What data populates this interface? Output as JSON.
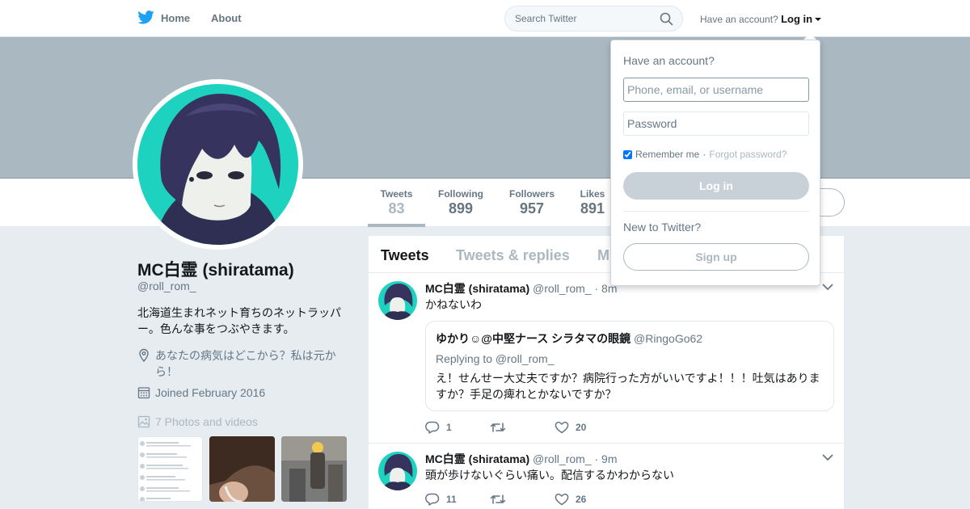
{
  "nav": {
    "home_label": "Home",
    "about_label": "About",
    "search_placeholder": "Search Twitter",
    "have_account": "Have an account?",
    "login_label": "Log in"
  },
  "profile": {
    "name": "MC白霊 (shiratama)",
    "handle": "@roll_rom_",
    "bio": "北海道生まれネット育ちのネットラッパー。色んな事をつぶやきます。",
    "location": "あなたの病気はどこから？私は元から！",
    "joined": "Joined February 2016",
    "photos_label": "7 Photos and videos"
  },
  "stats": [
    {
      "label": "Tweets",
      "value": "83"
    },
    {
      "label": "Following",
      "value": "899"
    },
    {
      "label": "Followers",
      "value": "957"
    },
    {
      "label": "Likes",
      "value": "891"
    }
  ],
  "timeline": {
    "tabs": [
      "Tweets",
      "Tweets & replies",
      "M"
    ],
    "tweets": [
      {
        "name": "MC白霊 (shiratama)",
        "handle": "@roll_rom_",
        "time": "· 8m",
        "text": "かねないわ",
        "quote": {
          "name": "ゆかり☺@中堅ナース シラタマの眼鏡",
          "handle": "@RingoGo62",
          "reply": "Replying to @roll_rom_",
          "text": "え！せんせー大丈夫ですか？病院行った方がいいですよ！！！吐気はありますか？手足の痺れとかないですか？"
        },
        "replies": "1",
        "retweets": "",
        "likes": "20"
      },
      {
        "name": "MC白霊 (shiratama)",
        "handle": "@roll_rom_",
        "time": "· 9m",
        "text": "頭が歩けないぐらい痛い。配信するかわからない",
        "replies": "11",
        "retweets": "",
        "likes": "26"
      }
    ]
  },
  "login_dropdown": {
    "heading": "Have an account?",
    "username_placeholder": "Phone, email, or username",
    "password_placeholder": "Password",
    "remember_label": "Remember me",
    "separator": "·",
    "forgot_label": "Forgot password?",
    "login_button": "Log in",
    "new_prompt": "New to Twitter?",
    "signup_button": "Sign up"
  },
  "colors": {
    "brand": "#1da1f2",
    "banner": "#aab8c2",
    "background": "#e6ecf0"
  },
  "icons": [
    "twitter-bird-icon",
    "home-icon",
    "search-icon",
    "location-icon",
    "calendar-icon",
    "photo-icon",
    "reply-icon",
    "retweet-icon",
    "like-icon",
    "chevron-down-icon"
  ]
}
